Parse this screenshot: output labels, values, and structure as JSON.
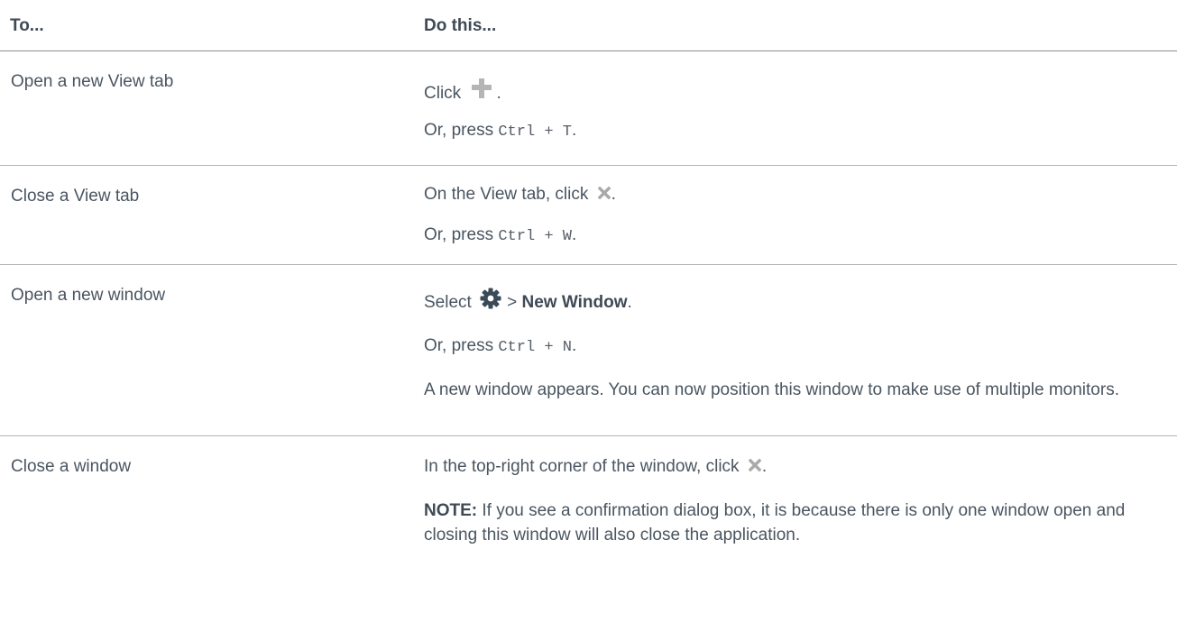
{
  "table": {
    "headers": [
      "To...",
      "Do this..."
    ],
    "rows": [
      {
        "action": "Open a new View tab",
        "steps": {
          "click_prefix": "Click",
          "click_suffix": ".",
          "or_press": "Or, press",
          "shortcut": "Ctrl + T",
          "period": "."
        }
      },
      {
        "action": "Close a View tab",
        "steps": {
          "click_prefix": "On the View tab, click",
          "click_suffix": ".",
          "or_press": "Or, press",
          "shortcut": "Ctrl + W",
          "period": "."
        }
      },
      {
        "action": "Open a new window",
        "steps": {
          "select_prefix": "Select",
          "separator": ">",
          "menu_item": "New Window",
          "select_suffix": ".",
          "or_press": "Or, press",
          "shortcut": "Ctrl + N",
          "period": ".",
          "result": "A new window appears. You can now position this window to make use of multiple monitors."
        }
      },
      {
        "action": "Close a window",
        "steps": {
          "click_prefix": "In the top-right corner of the window, click",
          "click_suffix": ".",
          "note_label": "NOTE:",
          "note_text": "If you see a confirmation dialog box, it is because there is only one window open and closing this window will also close the application."
        }
      }
    ]
  },
  "icons": {
    "plus": "plus-icon",
    "close": "close-icon",
    "gear": "gear-icon"
  },
  "colors": {
    "text": "#4a5560",
    "icon_gray": "#b5b5b5",
    "icon_dark": "#3a4a57"
  }
}
